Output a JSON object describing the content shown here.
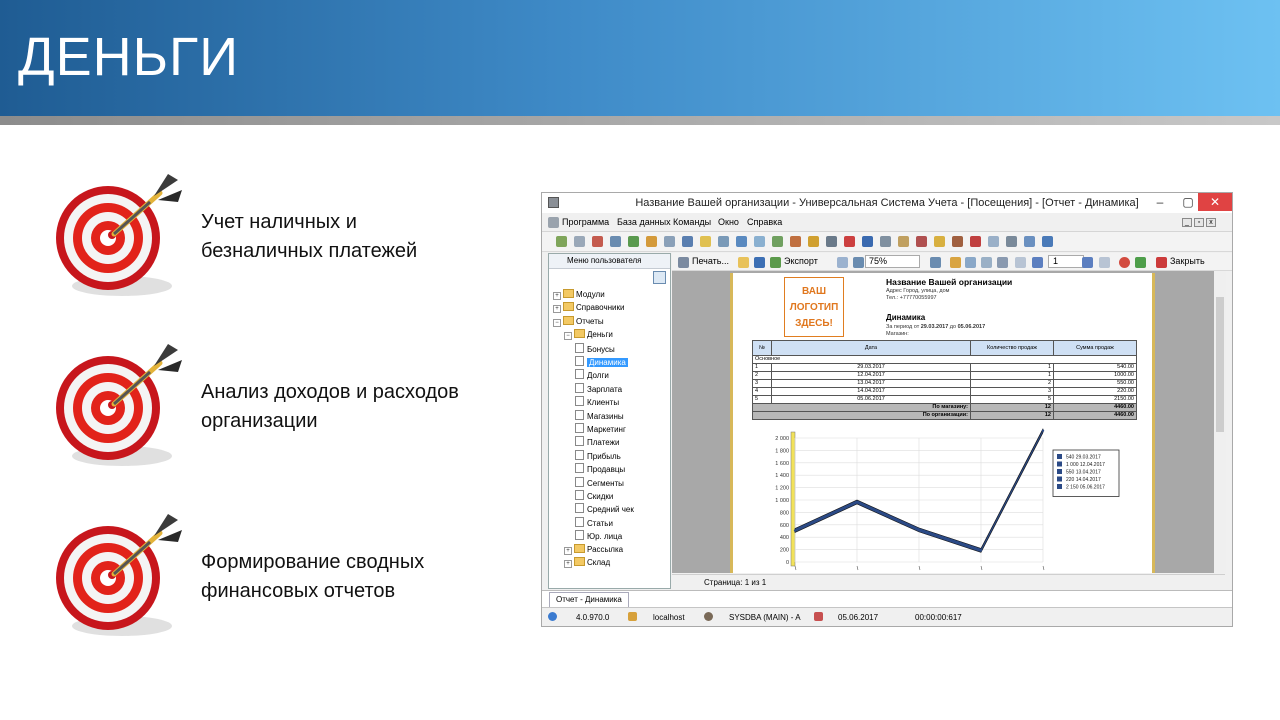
{
  "slide": {
    "title": "ДЕНЬГИ",
    "features": [
      {
        "line1": "Учет наличных и",
        "line2": "безналичных платежей"
      },
      {
        "line1": "Анализ доходов и расходов",
        "line2": "организации"
      },
      {
        "line1": "Формирование сводных",
        "line2": "финансовых отчетов"
      }
    ],
    "colors": {
      "header_dark": "#1f5c93",
      "header_light": "#6dc1f2",
      "target_red": "#e2231a"
    }
  },
  "app": {
    "window_title": "Название Вашей организации - Универсальная Система Учета - [Посещения] - [Отчет - Динамика]",
    "menu": [
      "Программа",
      "База данных",
      "Команды",
      "Окно",
      "Справка"
    ],
    "left_pane_title": "Меню пользователя",
    "tree": [
      {
        "label": "Модули",
        "kind": "folder",
        "level": 0,
        "sign": "+"
      },
      {
        "label": "Справочники",
        "kind": "folder",
        "level": 0,
        "sign": "+"
      },
      {
        "label": "Отчеты",
        "kind": "folder",
        "level": 0,
        "sign": "−"
      },
      {
        "label": "Деньги",
        "kind": "folder",
        "level": 1,
        "sign": "−"
      },
      {
        "label": "Бонусы",
        "kind": "doc",
        "level": 2
      },
      {
        "label": "Динамика",
        "kind": "doc",
        "level": 2,
        "selected": true
      },
      {
        "label": "Долги",
        "kind": "doc",
        "level": 2
      },
      {
        "label": "Зарплата",
        "kind": "doc",
        "level": 2
      },
      {
        "label": "Клиенты",
        "kind": "doc",
        "level": 2
      },
      {
        "label": "Магазины",
        "kind": "doc",
        "level": 2
      },
      {
        "label": "Маркетинг",
        "kind": "doc",
        "level": 2
      },
      {
        "label": "Платежи",
        "kind": "doc",
        "level": 2
      },
      {
        "label": "Прибыль",
        "kind": "doc",
        "level": 2
      },
      {
        "label": "Продавцы",
        "kind": "doc",
        "level": 2
      },
      {
        "label": "Сегменты",
        "kind": "doc",
        "level": 2
      },
      {
        "label": "Скидки",
        "kind": "doc",
        "level": 2
      },
      {
        "label": "Средний чек",
        "kind": "doc",
        "level": 2
      },
      {
        "label": "Статьи",
        "kind": "doc",
        "level": 2
      },
      {
        "label": "Юр. лица",
        "kind": "doc",
        "level": 2
      },
      {
        "label": "Рассылка",
        "kind": "folder",
        "level": 1,
        "sign": "+"
      },
      {
        "label": "Склад",
        "kind": "folder",
        "level": 1,
        "sign": "+"
      }
    ],
    "toolbar": {
      "print": "Печать...",
      "export": "Экспорт",
      "zoom": "75%",
      "page_input": "1",
      "close": "Закрыть"
    },
    "report": {
      "logo_lines": [
        "ВАШ",
        "ЛОГОТИП",
        "ЗДЕСЬ!"
      ],
      "org_name": "Название Вашей организации",
      "org_address": "Адрес Город, улица, дом",
      "org_phone": "Тел.: +77770055997",
      "report_title": "Динамика",
      "period_prefix": "За период от ",
      "period_from": "29.03.2017",
      "period_mid": " до ",
      "period_to": "05.06.2017",
      "store": "Магазин:",
      "columns": [
        "№",
        "Дата",
        "Количество продаж",
        "Сумма продаж"
      ],
      "group": "Основное",
      "rows": [
        [
          "1",
          "29.03.2017",
          "1",
          "540.00"
        ],
        [
          "2",
          "12.04.2017",
          "1",
          "1000.00"
        ],
        [
          "3",
          "13.04.2017",
          "2",
          "550.00"
        ],
        [
          "4",
          "14.04.2017",
          "3",
          "220.00"
        ],
        [
          "5",
          "05.06.2017",
          "5",
          "2150.00"
        ]
      ],
      "totals": [
        {
          "label": "По магазину:",
          "count": "12",
          "sum": "4460.00"
        },
        {
          "label": "По организации:",
          "count": "12",
          "sum": "4460.00"
        }
      ]
    },
    "chart_data": {
      "type": "line",
      "categories": [
        "29.03.2017",
        "12.04.2017",
        "13.04.2017",
        "14.04.2017",
        "05.06.2017"
      ],
      "values": [
        540,
        1000,
        550,
        220,
        2150
      ],
      "ylim": [
        0,
        2000
      ],
      "yticks": [
        "0",
        "200",
        "400",
        "600",
        "800",
        "1 000",
        "1 200",
        "1 400",
        "1 600",
        "1 800",
        "2 000"
      ],
      "legend": [
        "540 29.03.2017",
        "1 000 12.04.2017",
        "550 13.04.2017",
        "220 14.04.2017",
        "2 150 05.06.2017"
      ],
      "legend_position": "right",
      "color": "#2b4a86"
    },
    "page_status": "Страница: 1 из 1",
    "tab": "Отчет - Динамика",
    "status": {
      "version": "4.0.970.0",
      "host": "localhost",
      "user": "SYSDBA (MAIN) - A",
      "date": "05.06.2017",
      "time": "00:00:00:617"
    }
  }
}
